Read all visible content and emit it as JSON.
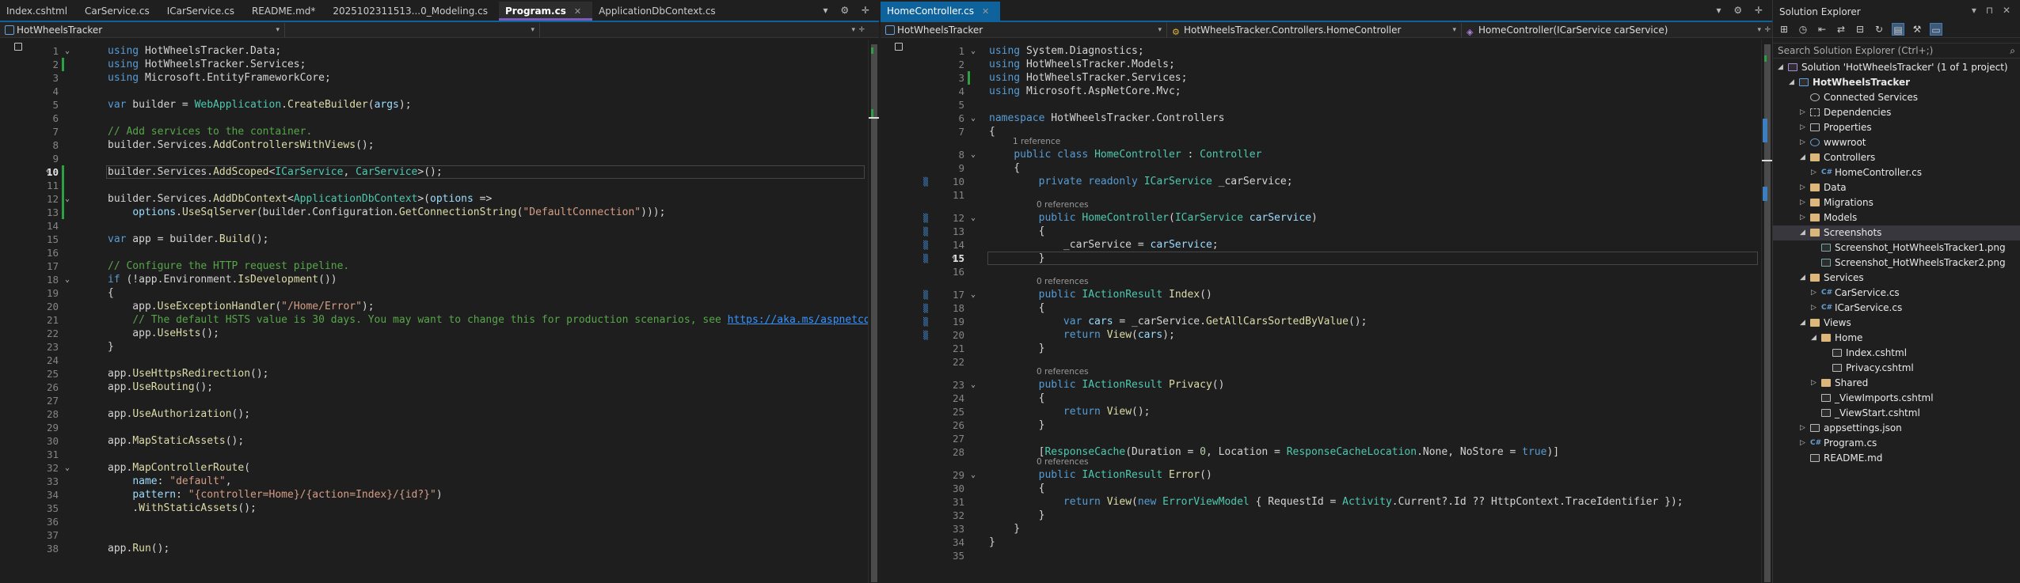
{
  "left_editor": {
    "tabs": [
      "Index.cshtml",
      "CarService.cs",
      "ICarService.cs",
      "README.md*",
      "20251023115133_0_Modeling.cs",
      "Program.cs",
      "ApplicationDbContext.cs"
    ],
    "tab_display": [
      "Index.cshtml",
      "CarService.cs",
      "ICarService.cs",
      "README.md*",
      "2025102311513...0_Modeling.cs",
      "Program.cs",
      "ApplicationDbContext.cs"
    ],
    "active_tab_index": 5,
    "nav_project": "HotWheelsTracker",
    "current_line": 10,
    "lines": [
      [
        "using HotWheelsTracker.Data;"
      ],
      [
        "using HotWheelsTracker.Services;"
      ],
      [
        "using Microsoft.EntityFrameworkCore;"
      ],
      [
        ""
      ],
      [
        "var builder = WebApplication.CreateBuilder(args);"
      ],
      [
        ""
      ],
      [
        "// Add services to the container."
      ],
      [
        "builder.Services.AddControllersWithViews();"
      ],
      [
        ""
      ],
      [
        "builder.Services.AddScoped<ICarService, CarService>();"
      ],
      [
        ""
      ],
      [
        "builder.Services.AddDbContext<ApplicationDbContext>(options =>"
      ],
      [
        "    options.UseSqlServer(builder.Configuration.GetConnectionString(\"DefaultConnection\")));"
      ],
      [
        ""
      ],
      [
        "var app = builder.Build();"
      ],
      [
        ""
      ],
      [
        "// Configure the HTTP request pipeline."
      ],
      [
        "if (!app.Environment.IsDevelopment())"
      ],
      [
        "{"
      ],
      [
        "    app.UseExceptionHandler(\"/Home/Error\");"
      ],
      [
        "    // The default HSTS value is 30 days. You may want to change this for production scenarios, see https://aka.ms/aspnetcore"
      ],
      [
        "    app.UseHsts();"
      ],
      [
        "}"
      ],
      [
        ""
      ],
      [
        "app.UseHttpsRedirection();"
      ],
      [
        "app.UseRouting();"
      ],
      [
        ""
      ],
      [
        "app.UseAuthorization();"
      ],
      [
        ""
      ],
      [
        "app.MapStaticAssets();"
      ],
      [
        ""
      ],
      [
        "app.MapControllerRoute("
      ],
      [
        "    name: \"default\","
      ],
      [
        "    pattern: \"{controller=Home}/{action=Index}/{id?}\")"
      ],
      [
        "    .WithStaticAssets();"
      ],
      [
        ""
      ],
      [
        ""
      ],
      [
        "app.Run();"
      ]
    ]
  },
  "right_editor": {
    "tabs": [
      "HomeController.cs"
    ],
    "active_tab_index": 0,
    "nav_project": "HotWheelsTracker",
    "nav_class": "HotWheelsTracker.Controllers.HomeController",
    "nav_member": "HomeController(ICarService carService)",
    "current_line": 15,
    "reference_labels": {
      "8": "1 reference",
      "12": "0 references",
      "17": "0 references",
      "23": "0 references",
      "29": "0 references"
    },
    "lines": [
      [
        "using System.Diagnostics;"
      ],
      [
        "using HotWheelsTracker.Models;"
      ],
      [
        "using HotWheelsTracker.Services;"
      ],
      [
        "using Microsoft.AspNetCore.Mvc;"
      ],
      [
        ""
      ],
      [
        "namespace HotWheelsTracker.Controllers"
      ],
      [
        "{"
      ],
      [
        "    public class HomeController : Controller"
      ],
      [
        "    {"
      ],
      [
        "        private readonly ICarService _carService;"
      ],
      [
        ""
      ],
      [
        "        public HomeController(ICarService carService)"
      ],
      [
        "        {"
      ],
      [
        "            _carService = carService;"
      ],
      [
        "        }"
      ],
      [
        ""
      ],
      [
        "        public IActionResult Index()"
      ],
      [
        "        {"
      ],
      [
        "            var cars = _carService.GetAllCarsSortedByValue();"
      ],
      [
        "            return View(cars);"
      ],
      [
        "        }"
      ],
      [
        ""
      ],
      [
        "        public IActionResult Privacy()"
      ],
      [
        "        {"
      ],
      [
        "            return View();"
      ],
      [
        "        }"
      ],
      [
        ""
      ],
      [
        "        [ResponseCache(Duration = 0, Location = ResponseCacheLocation.None, NoStore = true)]"
      ],
      [
        "        public IActionResult Error()"
      ],
      [
        "        {"
      ],
      [
        "            return View(new ErrorViewModel { RequestId = Activity.Current?.Id ?? HttpContext.TraceIdentifier });"
      ],
      [
        "        }"
      ],
      [
        "    }"
      ],
      [
        "}"
      ],
      [
        ""
      ]
    ]
  },
  "solution_explorer": {
    "title": "Solution Explorer",
    "search_placeholder": "Search Solution Explorer (Ctrl+;)",
    "items": [
      {
        "label": "Solution 'HotWheelsTracker' (1 of 1 project)",
        "depth": 0,
        "kind": "solution",
        "expanded": true
      },
      {
        "label": "HotWheelsTracker",
        "depth": 1,
        "kind": "project",
        "expanded": true,
        "bold": true
      },
      {
        "label": "Connected Services",
        "depth": 2,
        "kind": "svc"
      },
      {
        "label": "Dependencies",
        "depth": 2,
        "kind": "dep",
        "expander": true
      },
      {
        "label": "Properties",
        "depth": 2,
        "kind": "prop",
        "expander": true
      },
      {
        "label": "wwwroot",
        "depth": 2,
        "kind": "globe",
        "expander": true
      },
      {
        "label": "Controllers",
        "depth": 2,
        "kind": "folder",
        "expanded": true
      },
      {
        "label": "HomeController.cs",
        "depth": 3,
        "kind": "cs",
        "expander": true
      },
      {
        "label": "Data",
        "depth": 2,
        "kind": "folder",
        "expander": true
      },
      {
        "label": "Migrations",
        "depth": 2,
        "kind": "folder",
        "expander": true
      },
      {
        "label": "Models",
        "depth": 2,
        "kind": "folder",
        "expander": true
      },
      {
        "label": "Screenshots",
        "depth": 2,
        "kind": "folder",
        "expanded": true,
        "selected": true
      },
      {
        "label": "Screenshot_HotWheelsTracker1.png",
        "depth": 3,
        "kind": "img"
      },
      {
        "label": "Screenshot_HotWheelsTracker2.png",
        "depth": 3,
        "kind": "img"
      },
      {
        "label": "Services",
        "depth": 2,
        "kind": "folder",
        "expanded": true
      },
      {
        "label": "CarService.cs",
        "depth": 3,
        "kind": "cs",
        "expander": true
      },
      {
        "label": "ICarService.cs",
        "depth": 3,
        "kind": "cs",
        "expander": true
      },
      {
        "label": "Views",
        "depth": 2,
        "kind": "folder",
        "expanded": true
      },
      {
        "label": "Home",
        "depth": 3,
        "kind": "folder",
        "expanded": true
      },
      {
        "label": "Index.cshtml",
        "depth": 4,
        "kind": "file"
      },
      {
        "label": "Privacy.cshtml",
        "depth": 4,
        "kind": "file"
      },
      {
        "label": "Shared",
        "depth": 3,
        "kind": "folder",
        "expander": true
      },
      {
        "label": "_ViewImports.cshtml",
        "depth": 3,
        "kind": "file"
      },
      {
        "label": "_ViewStart.cshtml",
        "depth": 3,
        "kind": "file"
      },
      {
        "label": "appsettings.json",
        "depth": 2,
        "kind": "file",
        "expander": true
      },
      {
        "label": "Program.cs",
        "depth": 2,
        "kind": "cs",
        "expander": true
      },
      {
        "label": "README.md",
        "depth": 2,
        "kind": "file"
      }
    ]
  }
}
